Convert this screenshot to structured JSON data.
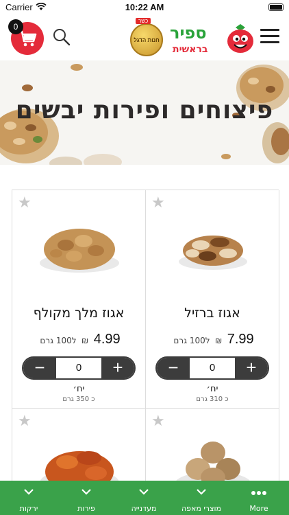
{
  "status_bar": {
    "carrier": "Carrier",
    "time": "10:22 AM"
  },
  "header": {
    "cart_count": "0",
    "brand_name": "ספיר",
    "brand_sub": "בראשית",
    "kosher_ribbon": "כשר",
    "kosher_text": "חנות הדגל",
    "kosher_since": "since 1991",
    "accent_color": "#e42b3a",
    "brand_color": "#2aa33a"
  },
  "banner": {
    "title": "פיצוחים ופירות יבשים"
  },
  "products": [
    {
      "name": "אגוז מלך מקולף",
      "price": "4.99",
      "currency": "₪",
      "unit": "ל100 גרם",
      "quantity": "0",
      "unit_label": "יח׳",
      "weight": "כ 350 גרם"
    },
    {
      "name": "אגוז ברזיל",
      "price": "7.99",
      "currency": "₪",
      "unit": "ל100 גרם",
      "quantity": "0",
      "unit_label": "יח׳",
      "weight": "כ 310 גרם"
    }
  ],
  "stepper": {
    "minus": "−",
    "plus": "+"
  },
  "tabbar": {
    "color": "#3aa24a",
    "tabs": [
      {
        "label": "ירקות",
        "icon": "chevron-down-icon"
      },
      {
        "label": "פירות",
        "icon": "chevron-down-icon"
      },
      {
        "label": "מעדנייה",
        "icon": "chevron-down-icon"
      },
      {
        "label": "מוצרי מאפה",
        "icon": "chevron-down-icon"
      },
      {
        "label": "More",
        "icon": "more-dots-icon"
      }
    ]
  }
}
